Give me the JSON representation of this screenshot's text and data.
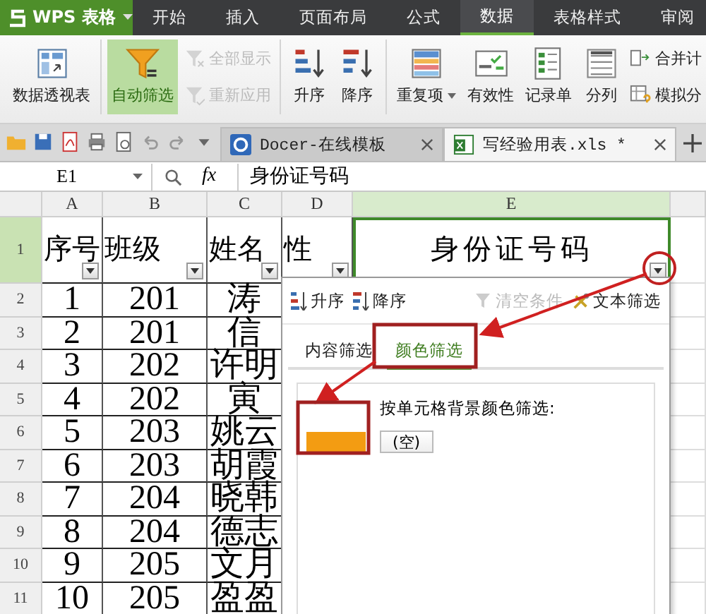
{
  "app_menu": {
    "label": "WPS 表格"
  },
  "menu": [
    {
      "label": "开始",
      "selected": false
    },
    {
      "label": "插入",
      "selected": false
    },
    {
      "label": "页面布局",
      "selected": false
    },
    {
      "label": "公式",
      "selected": false
    },
    {
      "label": "数据",
      "selected": true
    },
    {
      "label": "表格样式",
      "selected": false
    },
    {
      "label": "审阅",
      "selected": false
    }
  ],
  "ribbon": [
    {
      "items": [
        {
          "kind": "large",
          "label": "数据透视表",
          "active": false,
          "disabled": false
        }
      ]
    },
    {
      "items": [
        {
          "kind": "large",
          "label": "自动筛选",
          "active": true,
          "disabled": false
        },
        {
          "kind": "small",
          "label": "全部显示",
          "active": false,
          "disabled": true
        },
        {
          "kind": "small",
          "label": "重新应用",
          "active": false,
          "disabled": true
        }
      ]
    },
    {
      "items": [
        {
          "kind": "large",
          "label": "升序",
          "active": false,
          "disabled": false
        },
        {
          "kind": "large",
          "label": "降序",
          "active": false,
          "disabled": false
        }
      ]
    },
    {
      "items": [
        {
          "kind": "large",
          "label": "重复项",
          "dropdown": true,
          "active": false,
          "disabled": false
        },
        {
          "kind": "large",
          "label": "有效性",
          "active": false,
          "disabled": false
        },
        {
          "kind": "large",
          "label": "记录单",
          "active": false,
          "disabled": false
        },
        {
          "kind": "large",
          "label": "分列",
          "active": false,
          "disabled": false
        },
        {
          "kind": "small",
          "label": "合并计",
          "active": false,
          "disabled": false
        },
        {
          "kind": "small",
          "label": "模拟分",
          "active": false,
          "disabled": false
        }
      ]
    }
  ],
  "doc_tabs": [
    {
      "label": "Docer-在线模板",
      "selected": false
    },
    {
      "label": "写经验用表.xls *",
      "selected": true
    }
  ],
  "name_box": "E1",
  "formula_label": "fx",
  "formula": "身份证号码",
  "columns": [
    {
      "label": "A",
      "selected": false
    },
    {
      "label": "B",
      "selected": false
    },
    {
      "label": "C",
      "selected": false
    },
    {
      "label": "D",
      "selected": false
    },
    {
      "label": "E",
      "selected": true
    }
  ],
  "rows": [
    {
      "number": "1",
      "selected": true,
      "kind": "header",
      "cells": [
        "序号",
        "班级",
        "姓名",
        "性",
        "身份证号码"
      ]
    },
    {
      "number": "2",
      "selected": false,
      "kind": "data",
      "cells": [
        "1",
        "201",
        "涛"
      ]
    },
    {
      "number": "3",
      "selected": false,
      "kind": "data",
      "cells": [
        "2",
        "201",
        "信"
      ]
    },
    {
      "number": "4",
      "selected": false,
      "kind": "data",
      "cells": [
        "3",
        "202",
        "许明"
      ]
    },
    {
      "number": "5",
      "selected": false,
      "kind": "data",
      "cells": [
        "4",
        "202",
        "寅"
      ]
    },
    {
      "number": "6",
      "selected": false,
      "kind": "data",
      "cells": [
        "5",
        "203",
        "姚云"
      ]
    },
    {
      "number": "7",
      "selected": false,
      "kind": "data",
      "cells": [
        "6",
        "203",
        "胡霞"
      ]
    },
    {
      "number": "8",
      "selected": false,
      "kind": "data",
      "cells": [
        "7",
        "204",
        "晓韩"
      ]
    },
    {
      "number": "9",
      "selected": false,
      "kind": "data",
      "cells": [
        "8",
        "204",
        "德志"
      ]
    },
    {
      "number": "10",
      "selected": false,
      "kind": "data",
      "cells": [
        "9",
        "205",
        "文月"
      ]
    },
    {
      "number": "11",
      "selected": false,
      "kind": "data",
      "cells": [
        "10",
        "205",
        "盈盈"
      ]
    }
  ],
  "filter_popup": {
    "sort": [
      {
        "label": "升序"
      },
      {
        "label": "降序"
      }
    ],
    "clear": {
      "label": "清空条件",
      "disabled": true
    },
    "text_filter": {
      "label": "文本筛选"
    },
    "tabs": [
      {
        "label": "内容筛选",
        "selected": false
      },
      {
        "label": "颜色筛选",
        "selected": true
      }
    ],
    "prompt": "按单元格背景颜色筛选:",
    "colors": [
      {
        "kind": "swatch",
        "color": "#f39c12"
      },
      {
        "kind": "empty",
        "label": "(空)"
      }
    ]
  }
}
